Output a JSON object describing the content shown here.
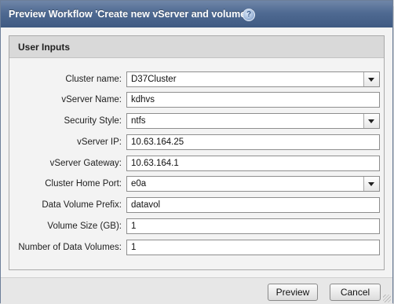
{
  "dialog": {
    "title": "Preview Workflow 'Create new vServer and volumes'",
    "help_icon_glyph": "?"
  },
  "user_inputs": {
    "header": "User Inputs",
    "fields": [
      {
        "label": "Cluster name:",
        "value": "D37Cluster",
        "type": "select"
      },
      {
        "label": "vServer Name:",
        "value": "kdhvs",
        "type": "text"
      },
      {
        "label": "Security Style:",
        "value": "ntfs",
        "type": "select"
      },
      {
        "label": "vServer IP:",
        "value": "10.63.164.25",
        "type": "text"
      },
      {
        "label": "vServer Gateway:",
        "value": "10.63.164.1",
        "type": "text"
      },
      {
        "label": "Cluster Home Port:",
        "value": "e0a",
        "type": "select"
      },
      {
        "label": "Data Volume Prefix:",
        "value": "datavol",
        "type": "text"
      },
      {
        "label": "Volume Size (GB):",
        "value": "1",
        "type": "text"
      },
      {
        "label": "Number of Data Volumes:",
        "value": "1",
        "type": "text"
      }
    ]
  },
  "footer": {
    "preview_label": "Preview",
    "cancel_label": "Cancel"
  },
  "colors": {
    "titlebar": "#4f6a92",
    "group_header": "#d9d9d9",
    "field_border": "#8e8e8e"
  }
}
